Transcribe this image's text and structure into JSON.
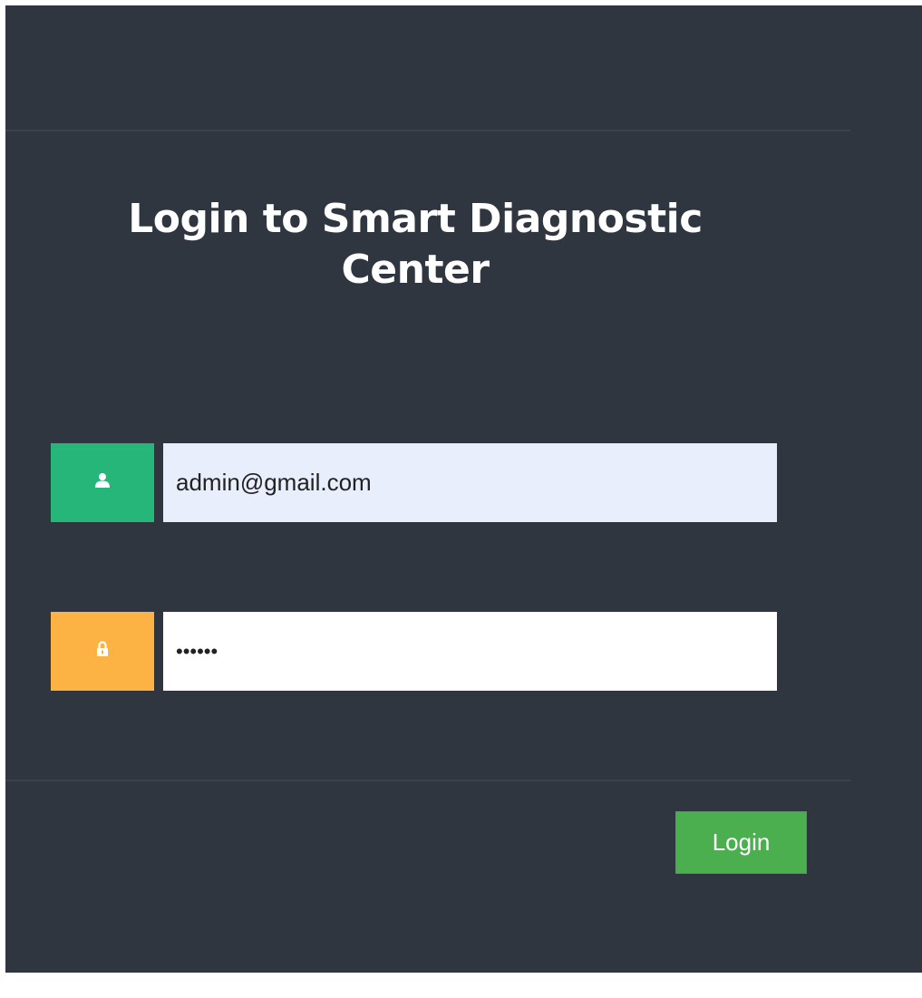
{
  "login": {
    "title": "Login to Smart Diagnostic Center",
    "email": {
      "value": "admin@gmail.com",
      "icon": "user-icon",
      "icon_bg": "#26b67a"
    },
    "password": {
      "value": "••••••",
      "icon": "lock-icon",
      "icon_bg": "#fdb343"
    },
    "submit_label": "Login",
    "colors": {
      "panel_bg": "#2f3640",
      "button_bg": "#4bae4f",
      "email_field_bg": "#e8eefb"
    }
  }
}
